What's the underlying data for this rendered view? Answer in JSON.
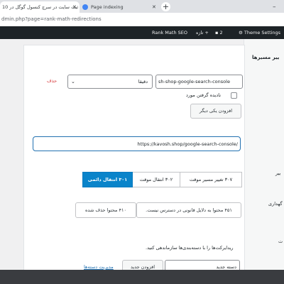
{
  "browser": {
    "tabs": [
      {
        "title": "ثبت سایت در سرچ کنسول گوگل در 10"
      },
      {
        "title": "Page indexing"
      }
    ],
    "new_tab": "+",
    "url": "dmin.php?page=rank-math-redirections"
  },
  "admin_bar": {
    "rank_math": "Rank Math SEO",
    "new_label": "تازه",
    "comments_count": "2",
    "theme_settings": "Theme Settings"
  },
  "form": {
    "section_title": "ییر مسیرها",
    "source_value": "sh-shop-google-search-console",
    "match_select": "دقیقا",
    "delete_link": "حذف",
    "ignore_case_label": "نادیده گرفتن مورد",
    "add_another": "افزودن یکی دیگر",
    "destination_value": "https://kavosh.shop/google-search-console/",
    "redirect_types": [
      {
        "label": "۳۰۷ تغییر مسیر موقت",
        "active": false
      },
      {
        "label": "۳۰۲ انتقال موقت",
        "active": false
      },
      {
        "label": "۳۰۱ انتقال دائمی",
        "active": true
      }
    ],
    "unavailable_types": [
      {
        "label": "۴۵۱ محتوا به دلایل قانونی در دسترس نیست."
      },
      {
        "label": "۴۱۰ محتوا حذف شده"
      }
    ],
    "categories_help": "ریدایرکت‌ها را با دسته‌بندی‌ها سازماندهی کنید.",
    "category_input": "دسته جدید",
    "add_new": "افزودن جدید",
    "manage_categories": "مدیریت دسته‌ها"
  },
  "side_labels": {
    "label_1": "بیر",
    "label_2": "گهداری",
    "label_3": "ت"
  }
}
